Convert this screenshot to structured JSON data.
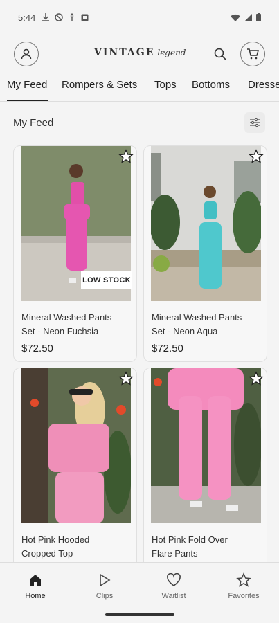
{
  "status_bar": {
    "time": "5:44"
  },
  "header": {
    "brand": "VINTAGE",
    "brand_script": "legend"
  },
  "tabs": [
    "My Feed",
    "Rompers & Sets",
    "Tops",
    "Bottoms",
    "Dresses"
  ],
  "feed": {
    "title": "My Feed",
    "products": [
      {
        "name_line1": "Mineral Washed Pants",
        "name_line2": "Set - Neon Fuchsia",
        "price": "$72.50",
        "badge": "LOW STOCK"
      },
      {
        "name_line1": "Mineral Washed Pants",
        "name_line2": "Set - Neon Aqua",
        "price": "$72.50"
      },
      {
        "name_line1": "Hot Pink Hooded",
        "name_line2": "Cropped Top"
      },
      {
        "name_line1": "Hot Pink Fold Over",
        "name_line2": "Flare Pants"
      }
    ]
  },
  "bottom_nav": [
    {
      "label": "Home",
      "icon": "home-icon",
      "active": true
    },
    {
      "label": "Clips",
      "icon": "play-icon"
    },
    {
      "label": "Waitlist",
      "icon": "heart-icon"
    },
    {
      "label": "Favorites",
      "icon": "star-icon"
    }
  ]
}
